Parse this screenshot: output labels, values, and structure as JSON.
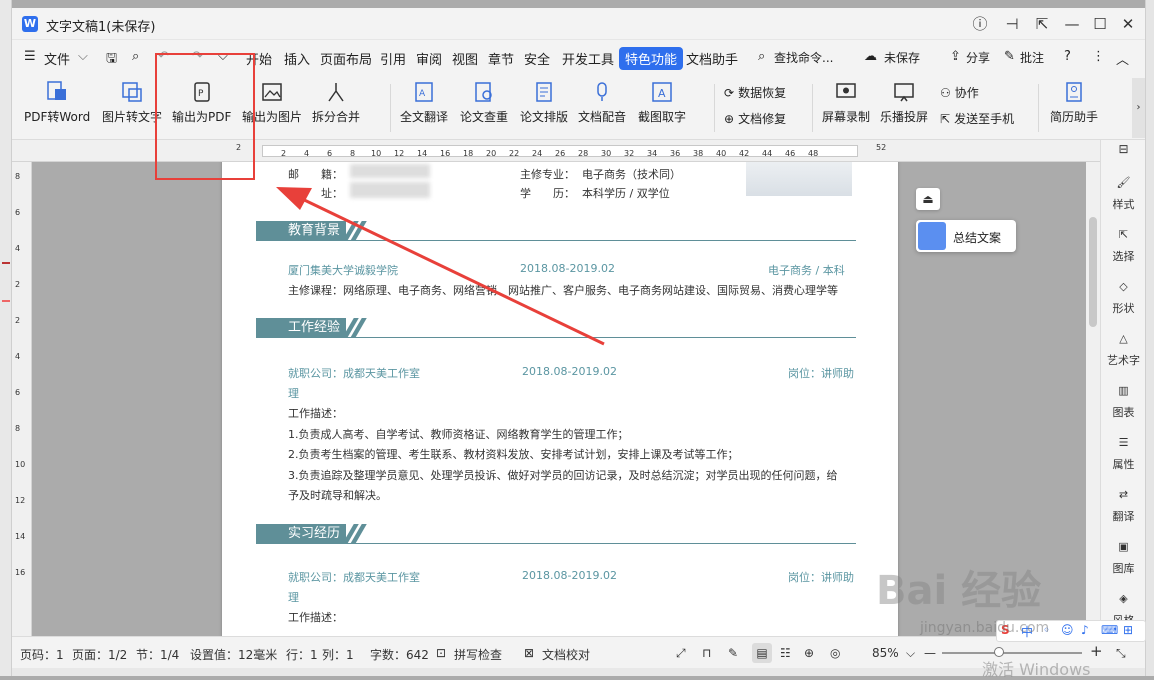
{
  "window": {
    "title": "文字文稿1(未保存)",
    "app_badge": "W"
  },
  "menu": {
    "file": "文件",
    "items": [
      "开始",
      "插入",
      "页面布局",
      "引用",
      "审阅",
      "视图",
      "章节",
      "安全",
      "开发工具"
    ],
    "special": "特色功能",
    "doc_helper": "文档助手",
    "search": "查找命令...",
    "unsaved": "未保存",
    "share": "分享",
    "comment": "批注"
  },
  "ribbon": {
    "pdf_to_word": "PDF转Word",
    "img_to_text": "图片转文字",
    "export_pdf": "输出为PDF",
    "export_img": "输出为图片",
    "split_merge": "拆分合并",
    "full_translate": "全文翻译",
    "paper_check": "论文查重",
    "paper_layout": "论文排版",
    "doc_voice": "文档配音",
    "screenshot_ocr": "截图取字",
    "data_recovery": "数据恢复",
    "doc_repair": "文档修复",
    "screen_record": "屏幕录制",
    "cast": "乐播投屏",
    "collab": "协作",
    "send_phone": "发送至手机",
    "resume": "简历助手"
  },
  "ruler": {
    "marks": [
      "2",
      "2",
      "4",
      "6",
      "8",
      "10",
      "12",
      "14",
      "16",
      "18",
      "20",
      "22",
      "24",
      "26",
      "28",
      "30",
      "32",
      "34",
      "36",
      "38",
      "40",
      "42",
      "44",
      "46",
      "48",
      "52"
    ],
    "vmarks": [
      "8",
      "6",
      "4",
      "2",
      "2",
      "4",
      "6",
      "8",
      "10",
      "12",
      "14",
      "16"
    ]
  },
  "resume": {
    "row1_label": "邮　　籍：",
    "row1_right_label": "主修专业：",
    "row1_right_value": "电子商务（技术同）",
    "row2_label": "住　　址：",
    "row2_right_label": "学　　历：",
    "row2_right_value": "本科学历 / 双学位",
    "edu_title": "教育背景",
    "edu_school": "厦门集美大学诚毅学院",
    "edu_date": "2018.08-2019.02",
    "edu_major": "电子商务 / 本科",
    "edu_courses": "主修课程：网络原理、电子商务、网络营销、网站推广、客户服务、电子商务网站建设、国际贸易、消费心理学等",
    "work_title": "工作经验",
    "work_company": "就职公司：成都天美工作室",
    "work_date": "2018.08-2019.02",
    "work_post": "岗位：讲师助",
    "work_post_cont": "理",
    "work_desc_label": "工作描述：",
    "work_d1": "1.负责成人高考、自学考试、教师资格证、网络教育学生的管理工作；",
    "work_d2": "2.负责考生档案的管理、考生联系、教材资料发放、安排考试计划，安排上课及考试等工作；",
    "work_d3": "3.负责追踪及整理学员意见、处理学员投诉、做好对学员的回访记录，及时总结沉淀；对学员出现的任何问题，给",
    "work_d3b": "予及时疏导和解决。",
    "intern_title": "实习经历",
    "intern_company": "就职公司：成都天美工作室",
    "intern_date": "2018.08-2019.02",
    "intern_post": "岗位：讲师助",
    "intern_post_cont": "理",
    "intern_desc_label": "工作描述："
  },
  "float_card": {
    "label": "总结文案"
  },
  "side_panel": [
    "样式",
    "选择",
    "形状",
    "艺术字",
    "图表",
    "属性",
    "翻译",
    "图库",
    "风格"
  ],
  "status": {
    "page_num": "页码：1",
    "pages": "页面：1/2",
    "section": "节：1/4",
    "setting": "设置值：12毫米",
    "line": "行：1",
    "col": "列：1",
    "words": "字数：642",
    "spell": "拼写检查",
    "proof": "文档校对",
    "zoom": "85%"
  },
  "overlay": {
    "watermark": "Bai 经验",
    "watermark_sub": "jingyan.baidu.com",
    "activate": "激活 Windows",
    "ime": "中"
  },
  "colors": {
    "accent": "#2f6fed",
    "section": "#5f8f98",
    "teal_text": "#5b96a2",
    "annotation": "#e8403a"
  }
}
